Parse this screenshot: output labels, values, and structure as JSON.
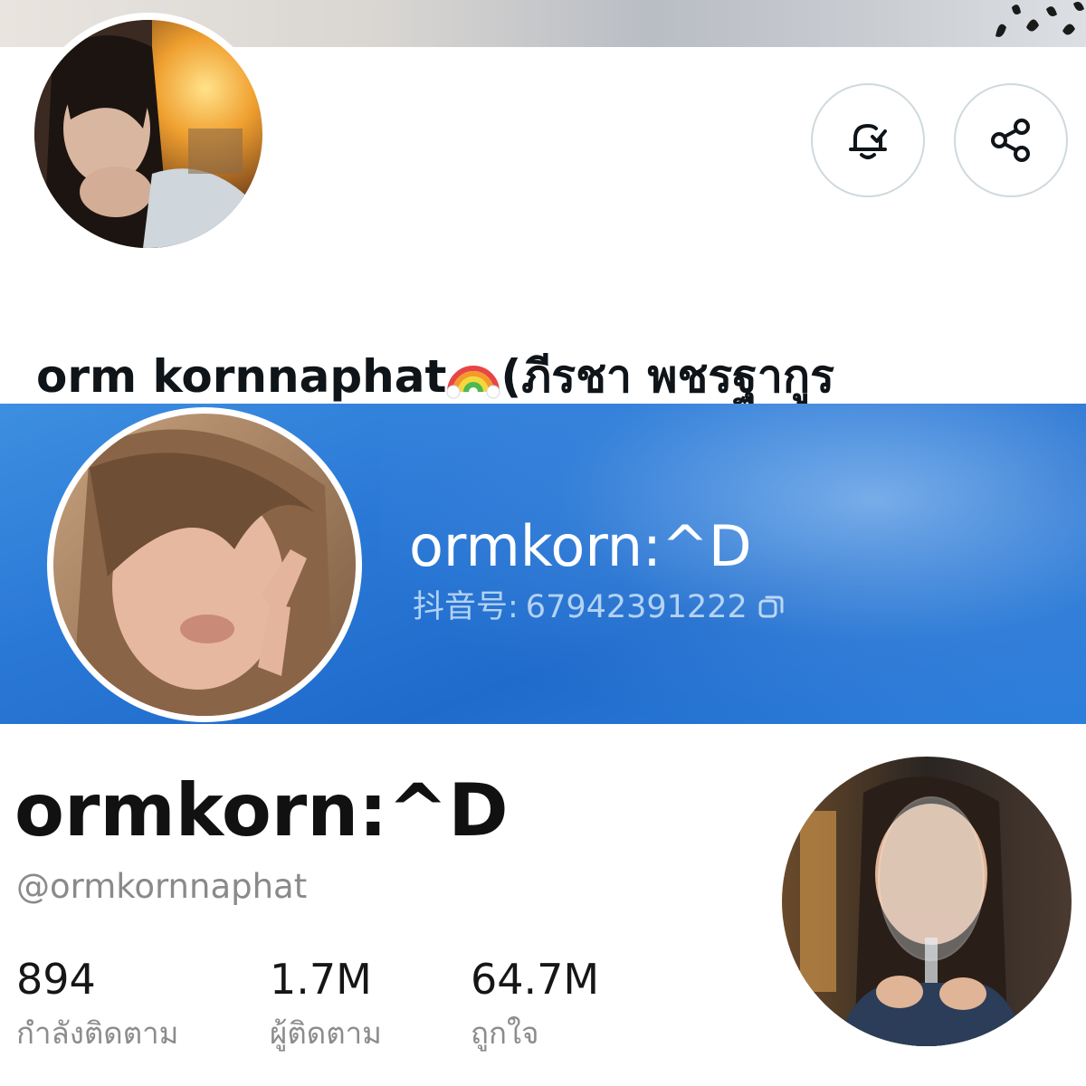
{
  "x_profile": {
    "display_name": "orm kornnaphat",
    "name_suffix": "(ภีรชา พชรฐากูร",
    "rainbow_icon": "rainbow-emoji",
    "notify_icon": "bell-check-icon",
    "share_icon": "share-icon"
  },
  "douyin_header": {
    "nickname": "ormkorn:^D",
    "id_label": "抖音号:",
    "id_value": "67942391222",
    "copy_icon": "copy-icon"
  },
  "tiktok_profile": {
    "nickname": "ormkorn:^D",
    "username": "@ormkornnaphat",
    "stats": [
      {
        "value": "894",
        "label": "กำลังติดตาม"
      },
      {
        "value": "1.7M",
        "label": "ผู้ติดตาม"
      },
      {
        "value": "64.7M",
        "label": "ถูกใจ"
      }
    ]
  },
  "colors": {
    "douyin_blue": "#2a78d6",
    "x_border": "#cfd9de",
    "text_dark": "#0f1419",
    "text_muted": "#8a8a8a"
  }
}
